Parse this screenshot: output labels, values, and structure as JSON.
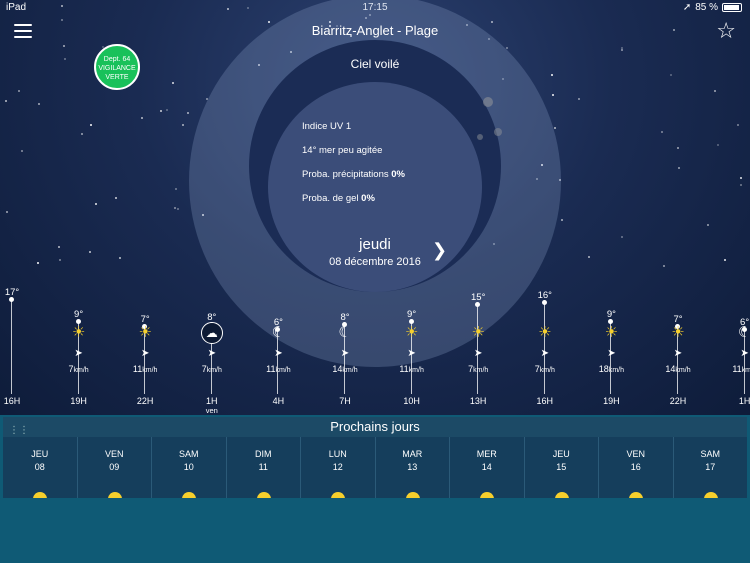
{
  "status": {
    "device": "iPad",
    "time": "17:15",
    "battery": "85 %"
  },
  "header": {
    "location": "Biarritz-Anglet - Plage"
  },
  "vigilance": {
    "line1": "Dept. 64",
    "line2": "VIGILANCE",
    "line3": "VERTE",
    "color": "#19c15a"
  },
  "current": {
    "condition": "Ciel voilé",
    "uv": "Indice UV 1",
    "sea_temp": "14°",
    "sea_state": "mer peu agitée",
    "precip_label": "Proba. précipitations",
    "precip_value": "0%",
    "frost_label": "Proba. de gel",
    "frost_value": "0%",
    "day": "jeudi",
    "date": "08 décembre 2016"
  },
  "hourly": [
    {
      "temp": "17°",
      "temp_value": 17,
      "icon": "none",
      "dir": "",
      "wind": "",
      "hour": "16H",
      "sub": ""
    },
    {
      "temp": "9°",
      "temp_value": 9,
      "icon": "sun-icon",
      "dir": "➤",
      "wind": "7",
      "hour": "19H",
      "sub": ""
    },
    {
      "temp": "7°",
      "temp_value": 7,
      "icon": "sun-icon",
      "dir": "➤",
      "wind": "11",
      "hour": "22H",
      "sub": ""
    },
    {
      "temp": "8°",
      "temp_value": 8,
      "icon": "night-cloud-icon",
      "dir": "➤",
      "wind": "7",
      "hour": "1H",
      "sub": "ven"
    },
    {
      "temp": "6°",
      "temp_value": 6,
      "icon": "moon-icon",
      "dir": "➤",
      "wind": "11",
      "hour": "4H",
      "sub": ""
    },
    {
      "temp": "8°",
      "temp_value": 8,
      "icon": "moon-icon",
      "dir": "➤",
      "wind": "14",
      "hour": "7H",
      "sub": ""
    },
    {
      "temp": "9°",
      "temp_value": 9,
      "icon": "sun-icon",
      "dir": "➤",
      "wind": "11",
      "hour": "10H",
      "sub": ""
    },
    {
      "temp": "15°",
      "temp_value": 15,
      "icon": "sun-icon",
      "dir": "➤",
      "wind": "7",
      "hour": "13H",
      "sub": ""
    },
    {
      "temp": "16°",
      "temp_value": 16,
      "icon": "sun-icon",
      "dir": "➤",
      "wind": "7",
      "hour": "16H",
      "sub": ""
    },
    {
      "temp": "9°",
      "temp_value": 9,
      "icon": "sun-icon",
      "dir": "➤",
      "wind": "18",
      "hour": "19H",
      "sub": ""
    },
    {
      "temp": "7°",
      "temp_value": 7,
      "icon": "sun-icon",
      "dir": "➤",
      "wind": "14",
      "hour": "22H",
      "sub": ""
    },
    {
      "temp": "6°",
      "temp_value": 6,
      "icon": "moon-icon",
      "dir": "➤",
      "wind": "11",
      "hour": "1H",
      "sub": ""
    }
  ],
  "wind_unit": "km/h",
  "next_days": {
    "title": "Prochains jours",
    "days": [
      {
        "name": "JEU",
        "num": "08"
      },
      {
        "name": "VEN",
        "num": "09"
      },
      {
        "name": "SAM",
        "num": "10"
      },
      {
        "name": "DIM",
        "num": "11"
      },
      {
        "name": "LUN",
        "num": "12"
      },
      {
        "name": "MAR",
        "num": "13"
      },
      {
        "name": "MER",
        "num": "14"
      },
      {
        "name": "JEU",
        "num": "15"
      },
      {
        "name": "VEN",
        "num": "16"
      },
      {
        "name": "SAM",
        "num": "17"
      }
    ]
  }
}
